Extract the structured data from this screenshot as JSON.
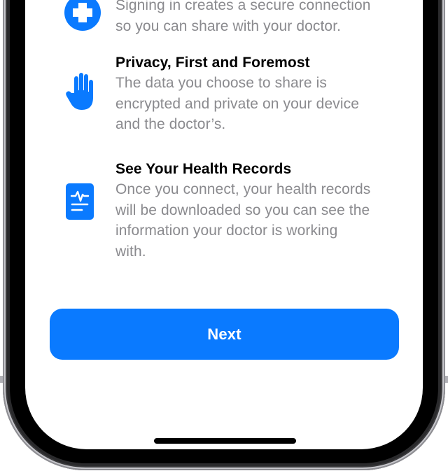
{
  "features": [
    {
      "icon": "medical-plus-icon",
      "title": "",
      "body_lines": [
        "Signing in creates a secure connection",
        "so you can share with your doctor."
      ]
    },
    {
      "icon": "hand-raised-icon",
      "title": "Privacy, First and Foremost",
      "body_lines": [
        "The data you choose to share is",
        "encrypted and private on your device",
        "and the doctor’s."
      ]
    },
    {
      "icon": "health-record-icon",
      "title": "See Your Health Records",
      "body_lines": [
        "Once you connect, your health records",
        "will be downloaded so you can see the",
        "information your doctor is working",
        "with."
      ]
    }
  ],
  "next_button": {
    "label": "Next"
  },
  "colors": {
    "accent": "#0a7aff",
    "title": "#000000",
    "body": "#8a8a8e",
    "frame": "#2a2a2c"
  }
}
